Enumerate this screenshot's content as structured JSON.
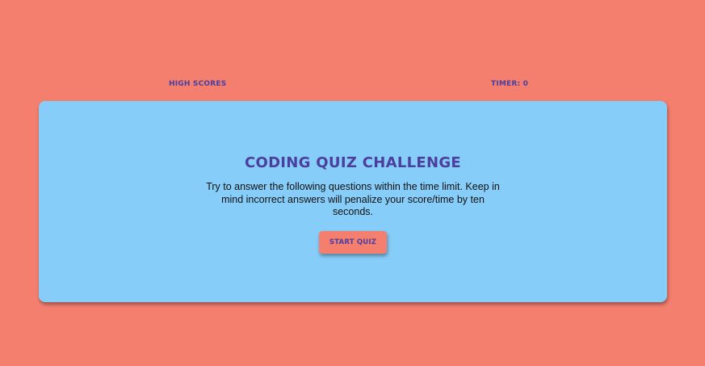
{
  "header": {
    "high_scores_label": "HIGH SCORES",
    "timer_label": "TIMER: 0"
  },
  "main": {
    "title": "CODING QUIZ CHALLENGE",
    "description": "Try to answer the following questions within the time limit. Keep in mind incorrect answers will penalize your score/time by ten seconds.",
    "start_button_label": "START QUIZ"
  },
  "colors": {
    "background": "#f47f6f",
    "card": "#87cdf9",
    "accent_text": "#4b3f9e"
  }
}
